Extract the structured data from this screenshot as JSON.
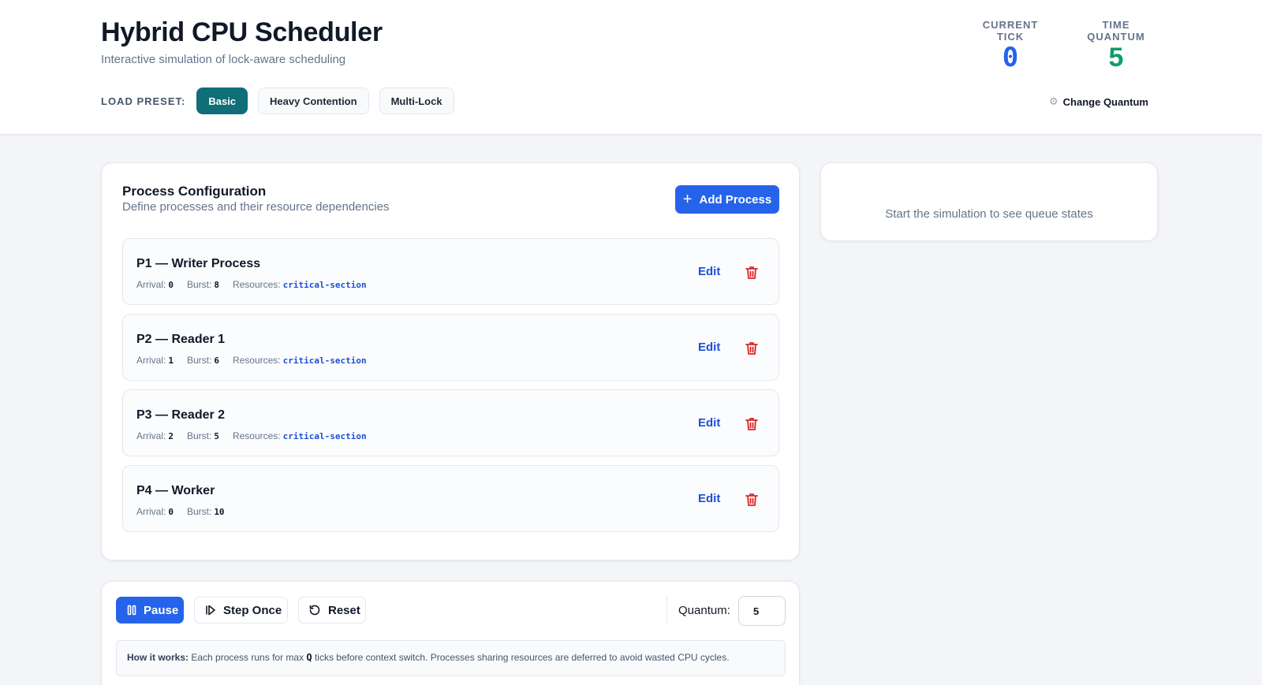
{
  "header": {
    "title": "Hybrid CPU Scheduler",
    "subtitle": "Interactive simulation of lock-aware scheduling",
    "preset_label": "LOAD PRESET:",
    "presets": [
      {
        "label": "Basic",
        "active": true
      },
      {
        "label": "Heavy Contention",
        "active": false
      },
      {
        "label": "Multi-Lock",
        "active": false
      }
    ],
    "current_tick_label": "CURRENT TICK",
    "current_tick": "0",
    "time_quantum_label": "TIME QUANTUM",
    "time_quantum": "5",
    "change_quantum_label": "Change Quantum"
  },
  "config": {
    "title": "Process Configuration",
    "subtitle": "Define processes and their resource dependencies",
    "add_label": "Add Process",
    "edit_label": "Edit",
    "arrival_label": "Arrival:",
    "burst_label": "Burst:",
    "resources_label": "Resources:",
    "processes": [
      {
        "name": "P1 — Writer Process",
        "arrival": "0",
        "burst": "8",
        "resources": "critical-section"
      },
      {
        "name": "P2 — Reader 1",
        "arrival": "1",
        "burst": "6",
        "resources": "critical-section"
      },
      {
        "name": "P3 — Reader 2",
        "arrival": "2",
        "burst": "5",
        "resources": "critical-section"
      },
      {
        "name": "P4 — Worker",
        "arrival": "0",
        "burst": "10",
        "resources": ""
      }
    ]
  },
  "queue": {
    "empty_message": "Start the simulation to see queue states"
  },
  "controls": {
    "pause_label": "Pause",
    "step_label": "Step Once",
    "reset_label": "Reset",
    "quantum_label": "Quantum:",
    "quantum_value": "5",
    "how_bold": "How it works:",
    "how_text_1": " Each process runs for max ",
    "how_q": "Q",
    "how_text_2": " ticks before context switch. Processes sharing resources are deferred to avoid wasted CPU cycles."
  },
  "colors": {
    "primary": "#2563eb",
    "preset_active": "#0f6e78",
    "quantum_value": "#0f9d6e",
    "delete": "#dc2626"
  }
}
